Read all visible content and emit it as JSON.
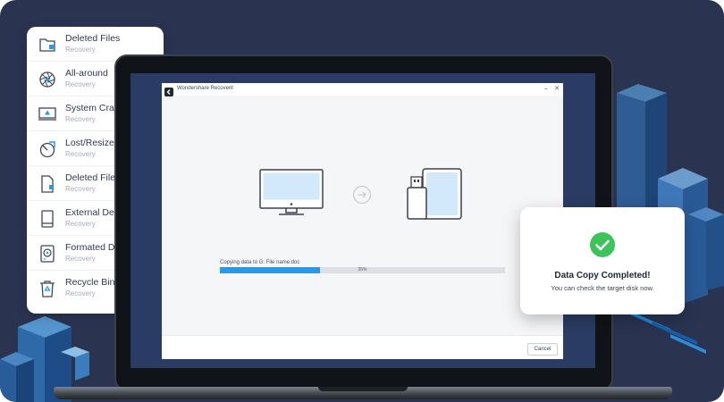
{
  "sidebar": {
    "items": [
      {
        "title": "Deleted Files",
        "subtitle": "Recovery",
        "icon": "folder-icon"
      },
      {
        "title": "All-around",
        "subtitle": "Recovery",
        "icon": "aperture-icon"
      },
      {
        "title": "System Crash",
        "subtitle": "Recovery",
        "icon": "warning-monitor-icon"
      },
      {
        "title": "Lost/Resized P",
        "subtitle": "Recovery",
        "icon": "partition-icon"
      },
      {
        "title": "Deleted Files",
        "subtitle": "Recovery",
        "icon": "document-icon"
      },
      {
        "title": "External Device",
        "subtitle": "Recovery",
        "icon": "external-drive-icon"
      },
      {
        "title": "Formated Drive",
        "subtitle": "Recovery",
        "icon": "hard-disk-icon"
      },
      {
        "title": "Recycle Bin",
        "subtitle": "Recovery",
        "icon": "recycle-bin-icon"
      }
    ]
  },
  "app": {
    "name": "Wondershare Recoverit",
    "copy_label": "Copying data to G: File name.doc",
    "progress": 35,
    "progress_text": "35%",
    "cancel_label": "Cancel",
    "minimize_glyph": "–",
    "close_glyph": "✕"
  },
  "notice": {
    "title": "Data Copy Completed!",
    "subtitle": "You can check the target disk now."
  },
  "colors": {
    "background": "#2a3451",
    "accent": "#1f9cf0",
    "success": "#3cc35a",
    "cube_light": "#3f8fd0",
    "cube_dark": "#2466a8"
  }
}
